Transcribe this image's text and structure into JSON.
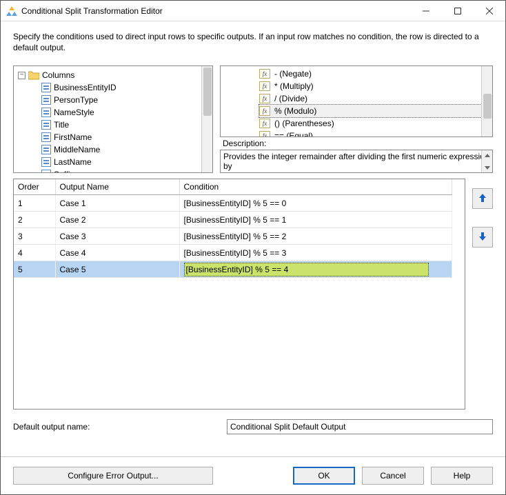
{
  "window": {
    "title": "Conditional Split Transformation Editor"
  },
  "instruction": "Specify the conditions used to direct input rows to specific outputs. If an input row matches no condition, the row is directed to a default output.",
  "tree": {
    "root": "Columns",
    "items": [
      "BusinessEntityID",
      "PersonType",
      "NameStyle",
      "Title",
      "FirstName",
      "MiddleName",
      "LastName",
      "Suffix"
    ]
  },
  "functions": {
    "items": [
      {
        "label": "- (Negate)"
      },
      {
        "label": "* (Multiply)"
      },
      {
        "label": "/ (Divide)"
      },
      {
        "label": "% (Modulo)",
        "selected": true
      },
      {
        "label": "() (Parentheses)"
      },
      {
        "label": "== (Equal)"
      }
    ],
    "desc_label": "Description:",
    "desc_text": "Provides the integer remainder after dividing the first numeric expression by"
  },
  "grid": {
    "headers": {
      "order": "Order",
      "name": "Output Name",
      "cond": "Condition"
    },
    "rows": [
      {
        "order": "1",
        "name": "Case 1",
        "cond": "[BusinessEntityID] % 5 == 0"
      },
      {
        "order": "2",
        "name": "Case 2",
        "cond": "[BusinessEntityID] % 5 == 1"
      },
      {
        "order": "3",
        "name": "Case 3",
        "cond": "[BusinessEntityID] % 5 == 2"
      },
      {
        "order": "4",
        "name": "Case 4",
        "cond": "[BusinessEntityID] % 5 == 3"
      },
      {
        "order": "5",
        "name": "Case 5",
        "cond": "[BusinessEntityID] % 5 == 4",
        "selected": true
      }
    ]
  },
  "default_output": {
    "label": "Default output name:",
    "value": "Conditional Split Default Output"
  },
  "buttons": {
    "configure": "Configure Error Output...",
    "ok": "OK",
    "cancel": "Cancel",
    "help": "Help"
  }
}
